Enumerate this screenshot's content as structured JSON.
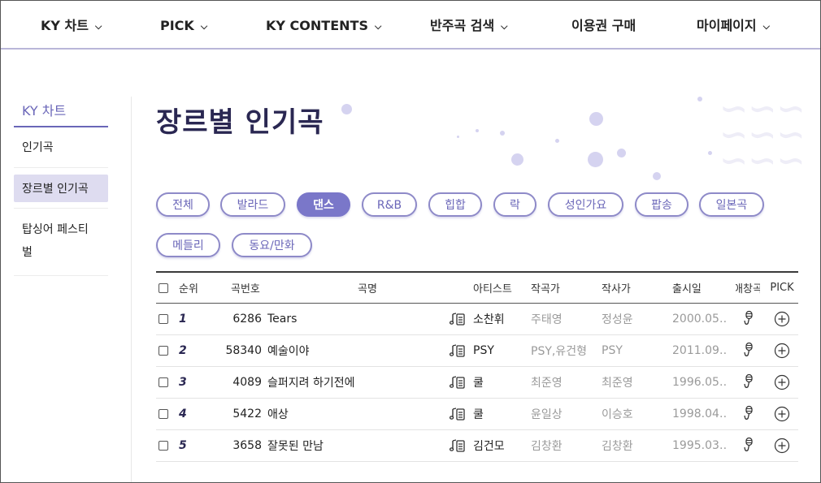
{
  "topnav": {
    "items": [
      {
        "label": "KY 차트",
        "has_dropdown": true
      },
      {
        "label": "PICK",
        "has_dropdown": true
      },
      {
        "label": "KY CONTENTS",
        "has_dropdown": true
      },
      {
        "label": "반주곡 검색",
        "has_dropdown": true
      },
      {
        "label": "이용권 구매",
        "has_dropdown": false
      },
      {
        "label": "마이페이지",
        "has_dropdown": true
      }
    ],
    "dropdown_icon": "chevron-down-icon"
  },
  "sidebar": {
    "title": "KY 차트",
    "items": [
      {
        "label": "인기곡",
        "active": false
      },
      {
        "label": "장르별 인기곡",
        "active": true
      },
      {
        "label_line1": "탑싱어 페스티",
        "label_line2": "벌",
        "active": false
      }
    ]
  },
  "page": {
    "title": "장르별 인기곡"
  },
  "genres": {
    "items": [
      "전체",
      "발라드",
      "댄스",
      "R&B",
      "힙합",
      "락",
      "성인가요",
      "팝송",
      "일본곡",
      "메들리",
      "동요/만화"
    ],
    "active": "댄스"
  },
  "table": {
    "headers": {
      "rank": "순위",
      "number": "곡번호",
      "title": "곡명",
      "artist": "아티스트",
      "composer": "작곡가",
      "lyricist": "작사가",
      "release": "출시일",
      "favorite": "애창곡",
      "pick": "PICK"
    },
    "rows": [
      {
        "rank": "1",
        "number": "6286",
        "title": "Tears",
        "artist": "소찬휘",
        "composer": "주태영",
        "lyricist": "정성윤",
        "release": "2000.05…"
      },
      {
        "rank": "2",
        "number": "58340",
        "title": "예술이야",
        "artist": "PSY",
        "composer": "PSY,유건형",
        "lyricist": "PSY",
        "release": "2011.09…"
      },
      {
        "rank": "3",
        "number": "4089",
        "title": "슬퍼지려 하기전에",
        "artist": "쿨",
        "composer": "최준영",
        "lyricist": "최준영",
        "release": "1996.05…"
      },
      {
        "rank": "4",
        "number": "5422",
        "title": "애상",
        "artist": "쿨",
        "composer": "윤일상",
        "lyricist": "이승호",
        "release": "1998.04…"
      },
      {
        "rank": "5",
        "number": "3658",
        "title": "잘못된 만남",
        "artist": "김건모",
        "composer": "김창환",
        "lyricist": "김창환",
        "release": "1995.03…"
      }
    ],
    "row_icons": {
      "lyrics": "music-lyrics-icon",
      "favorite": "microphone-icon",
      "pick": "plus-circle-icon"
    }
  },
  "colors": {
    "accent": "#7a77c9",
    "accent_text": "#6a66b8",
    "title": "#2a2752",
    "nav_border": "#b9b6d9"
  }
}
